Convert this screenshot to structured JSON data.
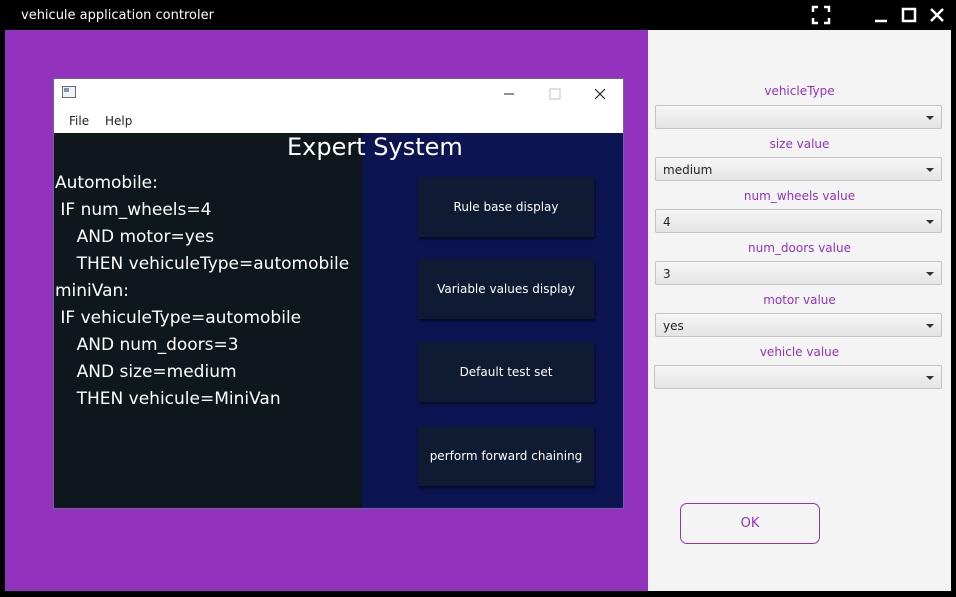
{
  "window": {
    "title": "vehicule application controler"
  },
  "inner_window": {
    "menu": [
      "File",
      "Help"
    ],
    "title": "Expert System",
    "rules": [
      "Automobile:",
      " IF num_wheels=4",
      "    AND motor=yes",
      "    THEN vehiculeType=automobile",
      "miniVan:",
      " IF vehiculeType=automobile",
      "    AND num_doors=3",
      "    AND size=medium",
      "    THEN vehicule=MiniVan"
    ],
    "buttons": [
      "Rule base display",
      "Variable values display",
      "Default test set",
      "perform forward chaining"
    ]
  },
  "form": {
    "fields": [
      {
        "label": "vehicleType",
        "value": ""
      },
      {
        "label": "size value",
        "value": "medium"
      },
      {
        "label": "num_wheels value",
        "value": "4"
      },
      {
        "label": "num_doors value",
        "value": "3"
      },
      {
        "label": "motor value",
        "value": "yes"
      },
      {
        "label": "vehicle value",
        "value": ""
      }
    ],
    "ok_label": "OK"
  },
  "colors": {
    "accent": "#9333bd",
    "rules_bg": "#0d171c",
    "buttons_bg": "#0c1552",
    "button_bg": "#0f1a33",
    "form_bg": "#f4f4f4"
  },
  "icons": [
    "fullscreen-icon",
    "minimize-icon",
    "maximize-icon",
    "close-icon",
    "app-icon",
    "dropdown-arrow-icon"
  ]
}
